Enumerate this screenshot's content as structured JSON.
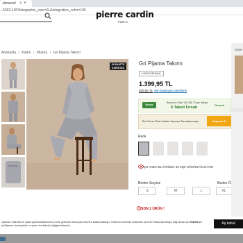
{
  "browser": {
    "tab_title": "Jstrasse/",
    "tab_close": "×",
    "tab_new": "+",
    "url": "...5663-1007integration_size=XL&integration_color=100"
  },
  "header": {
    "logo": "pierre cardin",
    "logo_sub": "PARIS"
  },
  "breadcrumb": {
    "items": [
      "Anasayfa",
      "›",
      "Kadın",
      "›",
      "Pijama",
      "›",
      "Gri Pijama Takımı"
    ]
  },
  "product": {
    "badge": "24 SAATTE KARGODA",
    "title": "Gri Pijama Takımı",
    "code_badge": "KARGO BEDAVA",
    "price": "1.399,95 TL",
    "installment_amount": "200,00 TL",
    "installment_text": "'den başlayan taksitlerle",
    "promo_line1": "Bonus'a Özel 10.000 TL'ye Varan",
    "promo_line2": "6 Taksit Fırsatı",
    "promo_left_logo": "Bonus",
    "promo_right_logo": "Garanti",
    "coupon_text": "Bu Ürüne Özel İndirim Kuponu Tanımlanmıştır.",
    "coupon_button": "Kuponu Al",
    "color_label": "Renk",
    "view_count": "ŞU ANDA BU ÜRÜNÜ 49 KİŞİ GÖRÜNTÜLÜYOR",
    "size_label": "Beden Seçiniz",
    "size_guide": "Beden Ö",
    "sizes": [
      "S",
      "M",
      "L",
      "XL"
    ],
    "last_item": "SON 1 ÜRÜN !"
  },
  "right_panel": {
    "label": "Sepe"
  },
  "cookie": {
    "text_start": "optimize edilmesi ve yasal yükümlülüklerimizi yerine getirmek amacıyla çerezleri kullanmaktayız. Platform üzerinde kullanılan çerezler hakkında detaylı bilgi almak için ",
    "text_bold": "Gizlilik ve",
    "text_end": " politikasını inceleyebilir ve çerez tercihlerini değiştirebilirsiniz.",
    "accept_label": "Aş kabul"
  },
  "colors": {
    "accent_orange": "#f2a614",
    "promo_green": "#2d7a2a",
    "warning_red": "#c41e1e"
  }
}
